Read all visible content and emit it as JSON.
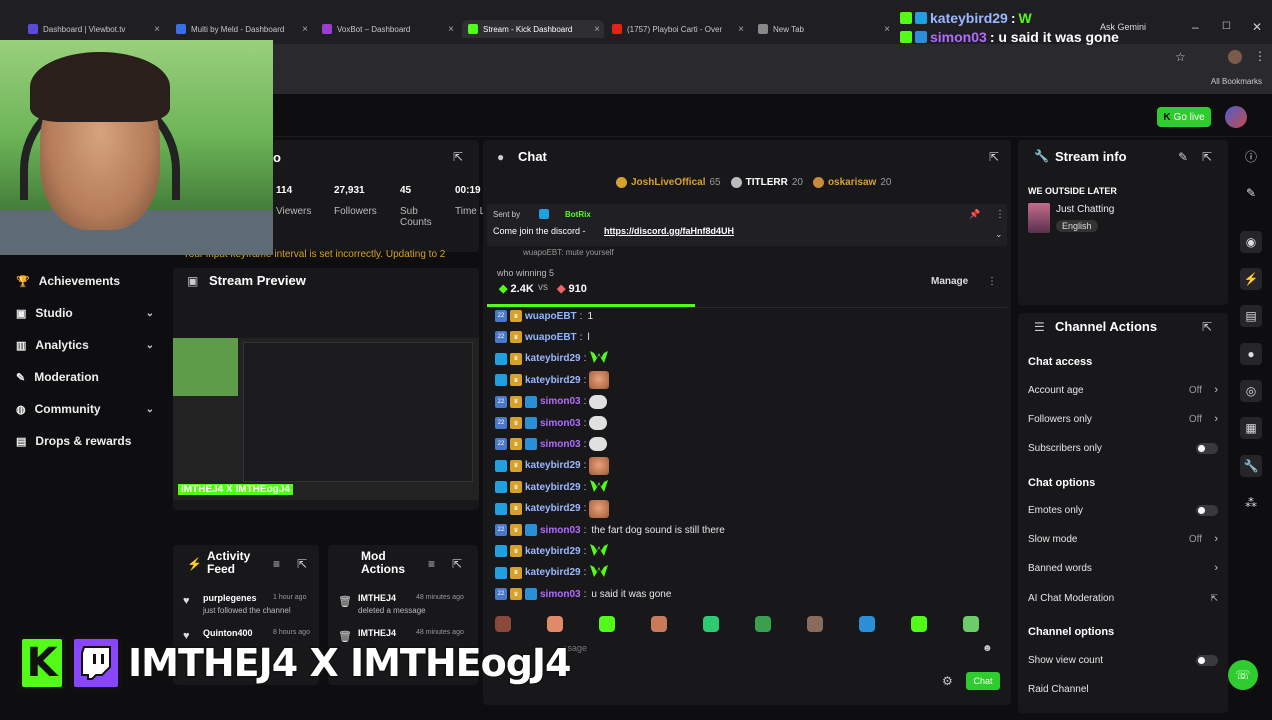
{
  "browser": {
    "tabs": [
      {
        "label": "Dashboard | Viewbot.tv",
        "color": "#5b4bd6"
      },
      {
        "label": "Multi by Meld - Dashboard",
        "color": "#3a6ee8"
      },
      {
        "label": "VoxBot – Dashboard",
        "color": "#9c3fd1"
      },
      {
        "label": "Stream - Kick Dashboard",
        "color": "#53fc18"
      },
      {
        "label": "(1757) Playboi Carti - Over",
        "color": "#e62117"
      },
      {
        "label": "New Tab",
        "color": "#888888"
      }
    ],
    "active_tab": 3,
    "ask_gemini": "Ask Gemini",
    "all_bookmarks": "All Bookmarks"
  },
  "notification": {
    "line1_user": "kateybird29",
    "line1_sep": ":",
    "line2_user": "simon03",
    "line2_text": ": u said it was gone"
  },
  "header": {
    "go_live": "Go live"
  },
  "stats": {
    "title_partial": "o",
    "items": [
      {
        "value": "114",
        "label": "Viewers"
      },
      {
        "value": "27,931",
        "label": "Followers"
      },
      {
        "value": "45",
        "label": "Sub Counts"
      },
      {
        "value": "00:19",
        "label": "Time Live"
      }
    ],
    "warning": "Your input keyframe interval is set incorrectly. Updating to 2"
  },
  "sidebar": {
    "items": [
      {
        "label": "Achievements",
        "icon": "trophy-icon",
        "chev": false
      },
      {
        "label": "Studio",
        "icon": "video-icon",
        "chev": true
      },
      {
        "label": "Analytics",
        "icon": "chart-icon",
        "chev": true
      },
      {
        "label": "Moderation",
        "icon": "wrench-icon",
        "chev": false
      },
      {
        "label": "Community",
        "icon": "globe-icon",
        "chev": true
      },
      {
        "label": "Drops & rewards",
        "icon": "gift-icon",
        "chev": false
      }
    ]
  },
  "preview": {
    "title": "Stream Preview",
    "overlay_label": "IMTHEJ4 X IMTHEogJ4"
  },
  "activity": {
    "title": "Activity Feed",
    "items": [
      {
        "user": "purplegenes",
        "time": "1 hour ago",
        "text": "just followed the channel"
      },
      {
        "user": "Quinton400",
        "time": "8 hours ago",
        "text": ""
      }
    ]
  },
  "mod_actions": {
    "title": "Mod Actions",
    "items": [
      {
        "user": "IMTHEJ4",
        "time": "48 minutes ago",
        "text": "deleted a message"
      },
      {
        "user": "IMTHEJ4",
        "time": "48 minutes ago",
        "text": ""
      }
    ]
  },
  "chat": {
    "title": "Chat",
    "leaders": [
      {
        "name": "JoshLiveOffical",
        "count": "65"
      },
      {
        "name": "TITLERR",
        "count": "20"
      },
      {
        "name": "oskarisaw",
        "count": "20"
      }
    ],
    "pinned": {
      "sent_by": "Sent by",
      "bot": "BotRix",
      "text": "Come join the discord - ",
      "link": "https://discord.gg/faHnf8d4UH"
    },
    "poll": {
      "question": "who winning 5",
      "a": "2.4K",
      "vs": "vs",
      "b": "910",
      "manage": "Manage",
      "fraction": 0.4
    },
    "partial_line": "wuapoEBT: mute yourself",
    "messages": [
      {
        "user": "wuapoEBT",
        "text": "1",
        "badges": "num-crown",
        "emote": "",
        "color": "#8fb7ff"
      },
      {
        "user": "wuapoEBT",
        "text": "l",
        "badges": "num-crown",
        "emote": "",
        "color": "#8fb7ff"
      },
      {
        "user": "kateybird29",
        "text": "",
        "badges": "kick-crown",
        "emote": "w",
        "color": "#9bb8ff"
      },
      {
        "user": "kateybird29",
        "text": "",
        "badges": "kick-crown",
        "emote": "face",
        "color": "#9bb8ff"
      },
      {
        "user": "simon03",
        "text": "",
        "badges": "num-crown-sub",
        "emote": "bubble",
        "color": "#b36bff"
      },
      {
        "user": "simon03",
        "text": "",
        "badges": "num-crown-sub",
        "emote": "bubble",
        "color": "#b36bff"
      },
      {
        "user": "simon03",
        "text": "",
        "badges": "num-crown-sub",
        "emote": "bubble",
        "color": "#b36bff"
      },
      {
        "user": "kateybird29",
        "text": "",
        "badges": "kick-crown",
        "emote": "face",
        "color": "#9bb8ff"
      },
      {
        "user": "kateybird29",
        "text": "",
        "badges": "kick-crown",
        "emote": "w",
        "color": "#9bb8ff"
      },
      {
        "user": "kateybird29",
        "text": "",
        "badges": "kick-crown",
        "emote": "face",
        "color": "#9bb8ff"
      },
      {
        "user": "simon03",
        "text": "the fart dog sound is still there",
        "badges": "num-crown-sub",
        "emote": "",
        "color": "#b36bff"
      },
      {
        "user": "kateybird29",
        "text": "",
        "badges": "kick-crown",
        "emote": "w",
        "color": "#9bb8ff"
      },
      {
        "user": "kateybird29",
        "text": "",
        "badges": "kick-crown",
        "emote": "w",
        "color": "#9bb8ff"
      },
      {
        "user": "simon03",
        "text": "u said it was gone",
        "badges": "num-crown-sub",
        "emote": "",
        "color": "#b36bff"
      }
    ],
    "input_placeholder": "ssage",
    "send": "Chat"
  },
  "stream_info": {
    "title": "Stream info",
    "stream_title": "WE OUTSIDE LATER",
    "category": "Just Chatting",
    "language": "English"
  },
  "channel_actions": {
    "title": "Channel Actions",
    "chat_access": "Chat access",
    "account_age": "Account age",
    "account_age_val": "Off",
    "followers_only": "Followers only",
    "followers_only_val": "Off",
    "subscribers_only": "Subscribers only",
    "chat_options": "Chat options",
    "emotes_only": "Emotes only",
    "slow_mode": "Slow mode",
    "slow_mode_val": "Off",
    "banned_words": "Banned words",
    "ai_mod": "AI Chat Moderation",
    "channel_options": "Channel options",
    "show_view_count": "Show view count",
    "raid_channel": "Raid Channel"
  },
  "overlay": {
    "text": "IMTHEJ4 X IMTHEogJ4"
  },
  "colors": {
    "accent": "#53fc18",
    "bg": "#0e0e10",
    "panel": "#18181b"
  }
}
